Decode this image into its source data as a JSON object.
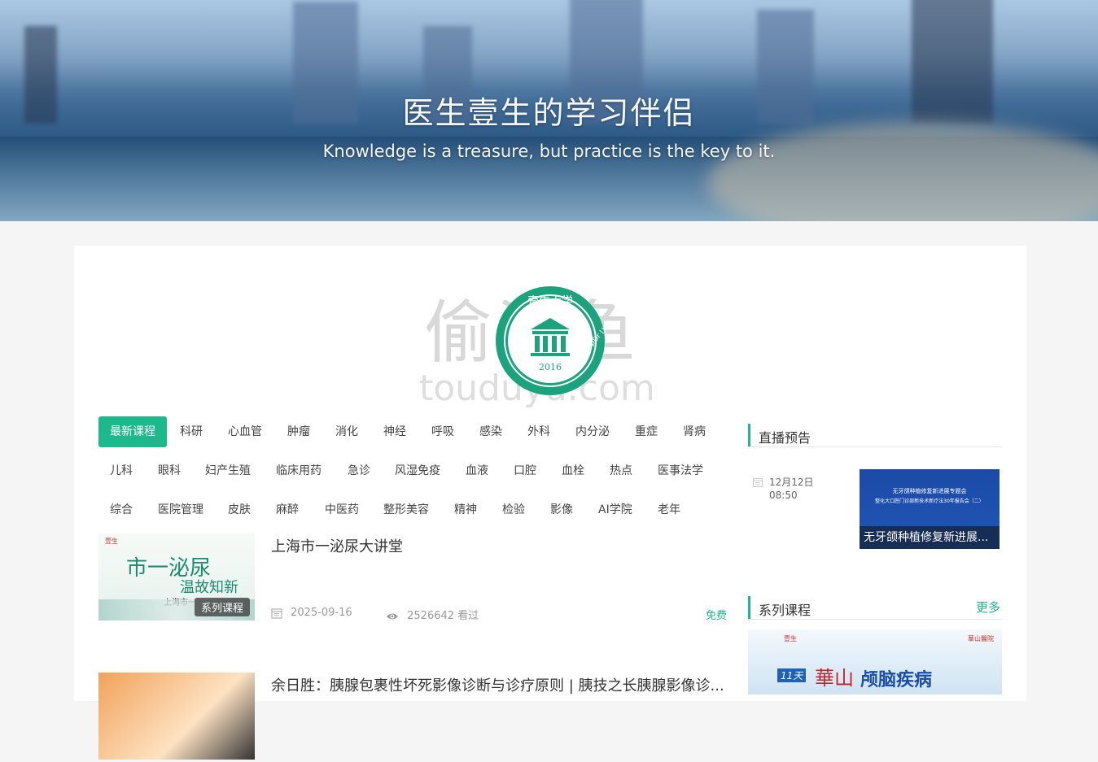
{
  "banner": {
    "title": "医生壹生的学习伴侣",
    "subtitle": "Knowledge is a treasure, but practice is the key to it."
  },
  "logo": {
    "arc_text": "壹生大学",
    "year": "2016",
    "ring_text": "CMTopDr UNIVERSITY",
    "watermark": "偷渡鱼",
    "watermark_domain": "touduyu.com"
  },
  "tabs": [
    [
      "最新课程",
      "科研",
      "心血管",
      "肿瘤",
      "消化",
      "神经",
      "呼吸",
      "感染",
      "外科",
      "内分泌",
      "重症",
      "肾病"
    ],
    [
      "儿科",
      "眼科",
      "妇产生殖",
      "临床用药",
      "急诊",
      "风湿免疫",
      "血液",
      "口腔",
      "血栓",
      "热点",
      "医事法学"
    ],
    [
      "综合",
      "医院管理",
      "皮肤",
      "麻醉",
      "中医药",
      "整形美容",
      "精神",
      "检验",
      "影像",
      "AI学院",
      "老年"
    ]
  ],
  "courses": [
    {
      "title": "上海市一泌尿大讲堂",
      "badge": "系列课程",
      "date": "2025-09-16",
      "views": "2526642 看过",
      "price": "免费",
      "thumb_text": "市一泌尿",
      "thumb_text2": "温故知新",
      "thumb_text3": "上海市一",
      "thumb_brand": "壹生"
    },
    {
      "title": "余日胜：胰腺包裹性坏死影像诊断与诊疗原则 | 胰技之长胰腺影像诊..."
    }
  ],
  "sidebar": {
    "live_header": "直播预告",
    "live_date": "12月12日",
    "live_time": "08:50",
    "live_caption": "无牙颌种植修复新进展...",
    "live_img_line1": "无牙颌种植修复新进展专题会",
    "live_img_line2": "整化大口腔门诊部新技术新疗法30年报告会（二）",
    "series_header": "系列课程",
    "series_more": "更多",
    "series_img_text1": "11天",
    "series_img_text2": "華山",
    "series_img_text3": "颅脑疾病",
    "series_img_brand": "壹生",
    "series_img_brand2": "華山醫院"
  },
  "colors": {
    "accent": "#1db88b",
    "badge_bg": "#3c3c3c"
  }
}
